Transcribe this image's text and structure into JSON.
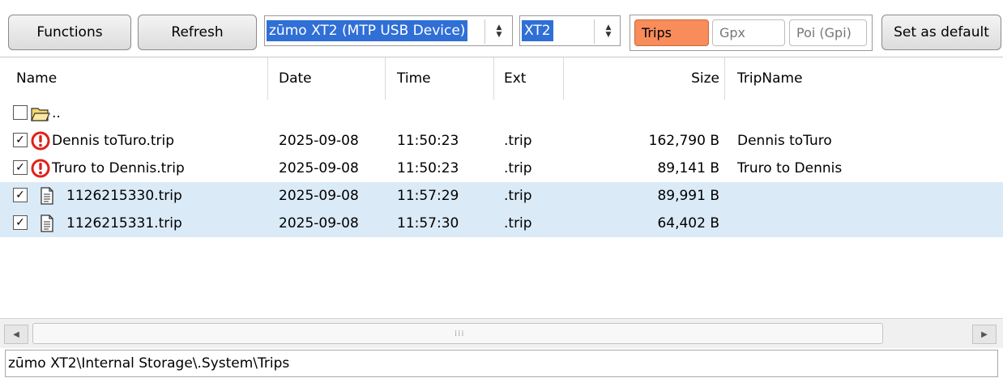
{
  "toolbar": {
    "functions_label": "Functions",
    "refresh_label": "Refresh",
    "device_select": "zūmo XT2 (MTP USB Device)",
    "model_select": "XT2",
    "tabs": [
      "Trips",
      "Gpx",
      "Poi (Gpi)"
    ],
    "active_tab": "Trips",
    "set_default_label": "Set as default"
  },
  "columns": [
    "Name",
    "Date",
    "Time",
    "Ext",
    "Size",
    "TripName"
  ],
  "rows": [
    {
      "checked": false,
      "icon": "folder-icon",
      "name": "..",
      "date": "",
      "time": "",
      "ext": "",
      "size": "",
      "tripname": ""
    },
    {
      "checked": true,
      "icon": "warning-icon",
      "name": "Dennis toTuro.trip",
      "date": "2025-09-08",
      "time": "11:50:23",
      "ext": ".trip",
      "size": "162,790 B",
      "tripname": "Dennis toTuro"
    },
    {
      "checked": true,
      "icon": "warning-icon",
      "name": "Truro to Dennis.trip",
      "date": "2025-09-08",
      "time": "11:50:23",
      "ext": ".trip",
      "size": "89,141 B",
      "tripname": "Truro to Dennis"
    },
    {
      "checked": true,
      "icon": "document-icon",
      "name": "1126215330.trip",
      "date": "2025-09-08",
      "time": "11:57:29",
      "ext": ".trip",
      "size": "89,991 B",
      "tripname": ""
    },
    {
      "checked": true,
      "icon": "document-icon",
      "name": "1126215331.trip",
      "date": "2025-09-08",
      "time": "11:57:30",
      "ext": ".trip",
      "size": "64,402 B",
      "tripname": ""
    }
  ],
  "selected_rows": [
    3,
    4
  ],
  "path": "zūmo XT2\\Internal Storage\\.System\\Trips",
  "colors": {
    "active_tab": "#f88c5a",
    "selection": "#dbeaf7",
    "highlight": "#2f6fd6",
    "warning": "#e0201a"
  }
}
